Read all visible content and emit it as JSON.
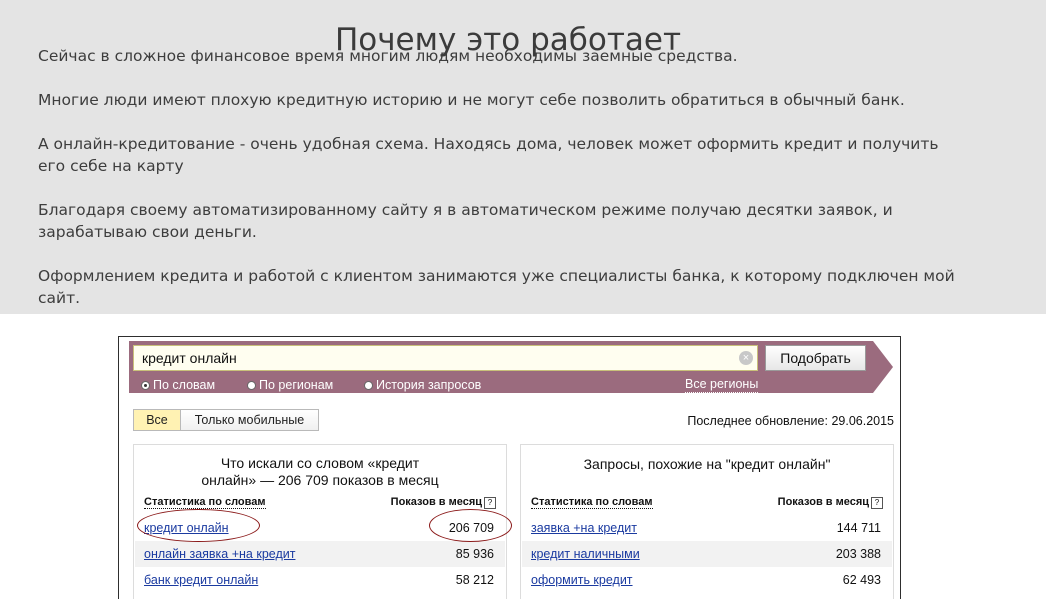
{
  "page": {
    "title": "Почему это работает",
    "paragraphs": [
      "Сейчас в сложное финансовое время многим людям необходимы заемные средства.",
      "Многие люди имеют плохую кредитную историю и не могут себе позволить обратиться в обычный банк.",
      "А онлайн-кредитование - очень удобная схема. Находясь дома, человек может оформить кредит и получить его себе на карту",
      "Благодаря своему автоматизированному сайту я в автоматическом режиме получаю десятки заявок, и зарабатываю свои деньги.",
      "Оформлением кредита и работой с клиентом занимаются уже специалисты банка, к которому подключен  мой сайт."
    ]
  },
  "screenshot": {
    "search": {
      "value": "кредит онлайн",
      "clear_icon": "clear-icon"
    },
    "pick_button": "Подобрать",
    "radios": [
      {
        "label": "По словам",
        "selected": true
      },
      {
        "label": "По регионам",
        "selected": false
      },
      {
        "label": "История запросов",
        "selected": false
      }
    ],
    "regions_link": "Все регионы",
    "tabs": [
      {
        "label": "Все",
        "active": true
      },
      {
        "label": "Только мобильные",
        "active": false
      }
    ],
    "last_update": "Последнее обновление: 29.06.2015",
    "left_panel": {
      "title_line1": "Что искали со словом «кредит",
      "title_line2": "онлайн» — 206 709 показов в месяц",
      "col_keyword": "Статистика по словам",
      "col_shows": "Показов в месяц",
      "help_icon": "?",
      "rows": [
        {
          "keyword": "кредит онлайн",
          "shows": "206 709"
        },
        {
          "keyword": "онлайн заявка +на кредит",
          "shows": "85 936"
        },
        {
          "keyword": "банк кредит онлайн",
          "shows": "58 212"
        }
      ]
    },
    "right_panel": {
      "title": "Запросы, похожие на \"кредит онлайн\"",
      "col_keyword": "Статистика по словам",
      "col_shows": "Показов в месяц",
      "help_icon": "?",
      "rows": [
        {
          "keyword": "заявка +на кредит",
          "shows": "144 711"
        },
        {
          "keyword": "кредит наличными",
          "shows": "203 388"
        },
        {
          "keyword": "оформить кредит",
          "shows": "62 493"
        }
      ]
    }
  }
}
